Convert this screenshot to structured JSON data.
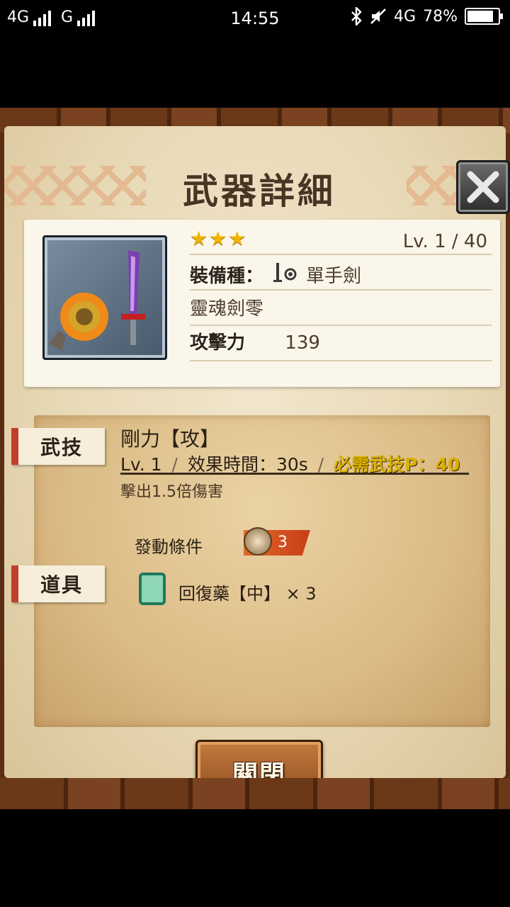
{
  "status_bar": {
    "network_1": "4G",
    "network_2": "G",
    "time": "14:55",
    "network_3": "4G",
    "battery": "78%"
  },
  "dialog": {
    "title": "武器詳細",
    "close_icon": "close-x-icon"
  },
  "weapon": {
    "stars": "★★★",
    "level": "Lv.   1   /  40",
    "equip_label": "裝備種：",
    "equip_type": "單手劍",
    "name": "靈魂劍零",
    "attack_label": "攻擊力",
    "attack_value": "139"
  },
  "skill": {
    "tag": "武技",
    "name": "剛力【攻】",
    "level": "Lv.   1",
    "duration": "效果時間：30s",
    "required": "必需武技P：40",
    "description": "擊出1.5倍傷害",
    "condition_label": "發動條件",
    "condition_value": "3"
  },
  "item": {
    "tag": "道具",
    "text": "回復藥【中】 × 3"
  },
  "buttons": {
    "close": "關閉"
  },
  "colors": {
    "highlight": "#d9b000",
    "tag_accent": "#c33d2b",
    "stars": "#f0b400"
  }
}
